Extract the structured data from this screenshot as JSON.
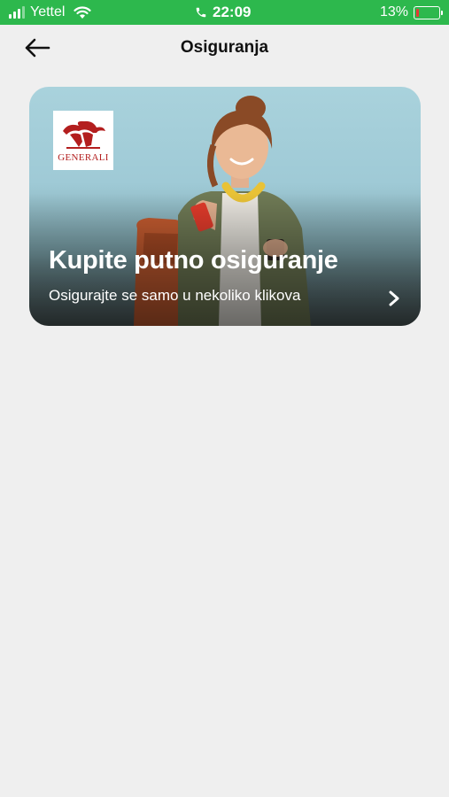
{
  "status_bar": {
    "carrier": "Yettel",
    "time": "22:09",
    "battery_percent": "13%",
    "battery_level": 0.13,
    "icons": [
      "signal-icon",
      "wifi-icon",
      "phone-icon",
      "battery-icon"
    ]
  },
  "header": {
    "title": "Osiguranja",
    "back_icon": "arrow-left-icon"
  },
  "card": {
    "logo_text": "GENERALI",
    "title": "Kupite putno osiguranje",
    "subtitle": "Osigurajte se samo u nekoliko klikova",
    "chevron_icon": "chevron-right-icon"
  },
  "colors": {
    "status_bar": "#2db84d",
    "background": "#efefef",
    "battery_low": "#e53935",
    "logo_red": "#b31e1e"
  }
}
